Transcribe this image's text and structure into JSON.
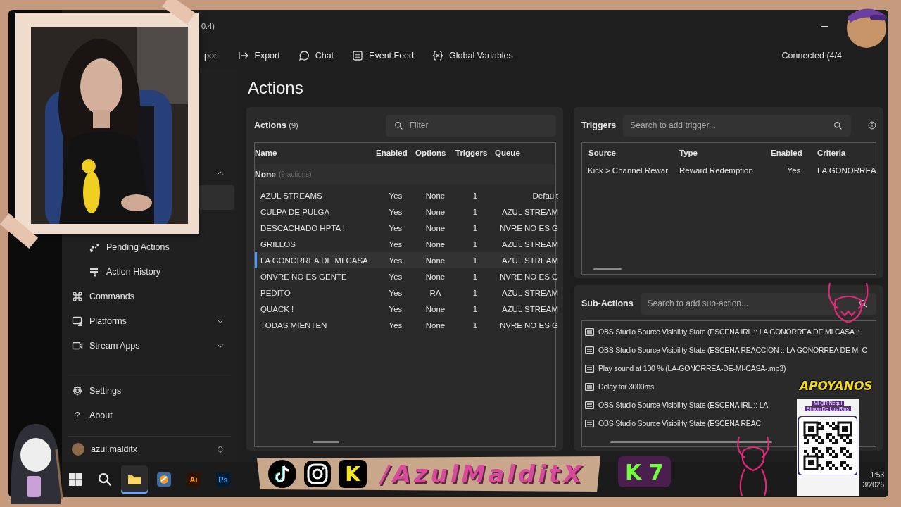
{
  "window": {
    "title": "0.4)"
  },
  "toolbar": {
    "items": [
      {
        "label": "port"
      },
      {
        "label": "Export"
      },
      {
        "label": "Chat"
      },
      {
        "label": "Event Feed"
      },
      {
        "label": "Global Variables"
      }
    ],
    "status": "Connected (4/4"
  },
  "sidebar": {
    "items": [
      {
        "kind": "group",
        "expanded": true,
        "children": [
          {
            "selected": true
          },
          {
            "label": "Pending Actions",
            "selected": false
          },
          {
            "label": "Action History",
            "selected": false
          }
        ]
      },
      {
        "kind": "link",
        "label": "Commands"
      },
      {
        "kind": "group",
        "label": "Platforms",
        "expanded": false
      },
      {
        "kind": "group",
        "label": "Stream Apps",
        "expanded": false
      }
    ],
    "footer": [
      {
        "label": "Settings"
      },
      {
        "label": "About",
        "glyph": "?"
      }
    ],
    "user": {
      "name": "azul.malditx"
    }
  },
  "page_title": "Actions",
  "actions": {
    "title": "Actions",
    "count": "(9)",
    "filter": {
      "placeholder": "Filter"
    },
    "columns": [
      "Name",
      "Enabled",
      "Options",
      "Triggers",
      "Queue"
    ],
    "groups": [
      {
        "name": "None",
        "count": "(9 actions)",
        "rows": [
          {
            "name": "AZUL STREAMS",
            "enabled": "Yes",
            "options": "None",
            "triggers": "1",
            "queue": "Default",
            "selected": false
          },
          {
            "name": "CULPA DE PULGA",
            "enabled": "Yes",
            "options": "None",
            "triggers": "1",
            "queue": "AZUL STREAM",
            "selected": false
          },
          {
            "name": "DESCACHADO HPTA !",
            "enabled": "Yes",
            "options": "None",
            "triggers": "1",
            "queue": "NVRE NO ES G",
            "selected": false
          },
          {
            "name": "GRILLOS",
            "enabled": "Yes",
            "options": "None",
            "triggers": "1",
            "queue": "AZUL STREAM",
            "selected": false
          },
          {
            "name": "LA GONORREA DE MI CASA",
            "enabled": "Yes",
            "options": "None",
            "triggers": "1",
            "queue": "AZUL STREAM",
            "selected": true
          },
          {
            "name": "ONVRE NO ES GENTE",
            "enabled": "Yes",
            "options": "None",
            "triggers": "1",
            "queue": "NVRE NO ES G",
            "selected": false
          },
          {
            "name": "PEDITO",
            "enabled": "Yes",
            "options": "RA",
            "triggers": "1",
            "queue": "AZUL STREAM",
            "selected": false
          },
          {
            "name": "QUACK !",
            "enabled": "Yes",
            "options": "None",
            "triggers": "1",
            "queue": "AZUL STREAM",
            "selected": false
          },
          {
            "name": "TODAS MIENTEN",
            "enabled": "Yes",
            "options": "None",
            "triggers": "1",
            "queue": "NVRE NO ES G",
            "selected": false
          }
        ]
      }
    ]
  },
  "triggers": {
    "title": "Triggers",
    "search": {
      "placeholder": "Search to add trigger..."
    },
    "columns": [
      "Source",
      "Type",
      "Enabled",
      "Criteria"
    ],
    "rows": [
      {
        "source": "Kick > Channel Rewar",
        "type": "Reward Redemption",
        "enabled": "Yes",
        "criteria": "LA GONORREA"
      }
    ]
  },
  "sub_actions": {
    "title": "Sub-Actions",
    "search": {
      "placeholder": "Search to add sub-action..."
    },
    "items": [
      "OBS Studio Source Visibility State (ESCENA IRL :: LA GONORREA DE MI CASA ::",
      "OBS Studio Source Visibility State (ESCENA REACCION :: LA GONORREA DE MI C",
      "Play sound at 100 % (LA-GONORREA-DE-MI-CASA-.mp3)",
      "Delay for 3000ms",
      "OBS Studio Source Visibility State (ESCENA IRL :: LA",
      "OBS Studio Source Visibility State (ESCENA REAC"
    ]
  },
  "taskbar": {
    "apps": [
      {
        "kind": "windows",
        "active": false
      },
      {
        "kind": "search",
        "active": false
      },
      {
        "kind": "folder",
        "active": true
      },
      {
        "kind": "browser",
        "active": false
      },
      {
        "kind": "illustrator",
        "label": "Ai",
        "active": false
      },
      {
        "kind": "photoshop",
        "label": "Ps",
        "active": false
      }
    ],
    "clock": {
      "time": "1:53",
      "date": "3/2026"
    }
  },
  "overlay": {
    "socials": [
      {
        "kind": "tiktok"
      },
      {
        "kind": "instagram"
      },
      {
        "kind": "kick",
        "label": "K"
      }
    ],
    "handle": "/AzulMalditX",
    "badge": "K 7",
    "support": {
      "title": "APOYANOS",
      "lines": [
        "Mi QR Nequi",
        "Simon De Los Rios"
      ]
    }
  }
}
